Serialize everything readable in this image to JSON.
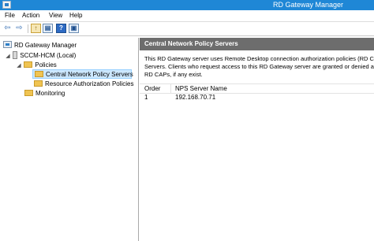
{
  "window": {
    "title": "RD Gateway Manager"
  },
  "menu": {
    "items": [
      "File",
      "Action",
      "View",
      "Help"
    ]
  },
  "toolbar": {
    "buttons": [
      {
        "icon": "back-arrow-icon",
        "glyph": "⇦"
      },
      {
        "icon": "forward-arrow-icon",
        "glyph": "⇨"
      },
      {
        "icon": "up-folder-icon",
        "glyph": "↑"
      },
      {
        "icon": "show-hide-tree-icon",
        "glyph": "▤"
      },
      {
        "icon": "help-icon",
        "glyph": "?"
      },
      {
        "icon": "properties-icon",
        "glyph": "▣"
      }
    ]
  },
  "tree": {
    "root": "RD Gateway Manager",
    "server": "SCCM-HCM (Local)",
    "policies": "Policies",
    "central_nps": "Central Network Policy Servers",
    "resource_policies": "Resource Authorization Policies",
    "monitoring": "Monitoring",
    "expanded_glyph": "◢"
  },
  "panel": {
    "header": "Central Network Policy Servers",
    "description_lines": [
      "This RD Gateway server uses Remote Desktop connection authorization policies (RD CAPs",
      "Servers. Clients who request access to this RD Gateway server are granted or denied acces",
      "RD CAPs, if any exist."
    ]
  },
  "table": {
    "columns": [
      "Order",
      "NPS Server Name"
    ],
    "rows": [
      {
        "order": "1",
        "name": "192.168.70.71"
      }
    ]
  },
  "colors": {
    "titlebar": "#1f87d6",
    "panel_header": "#6d6d6d",
    "selection": "#cde8ff"
  }
}
